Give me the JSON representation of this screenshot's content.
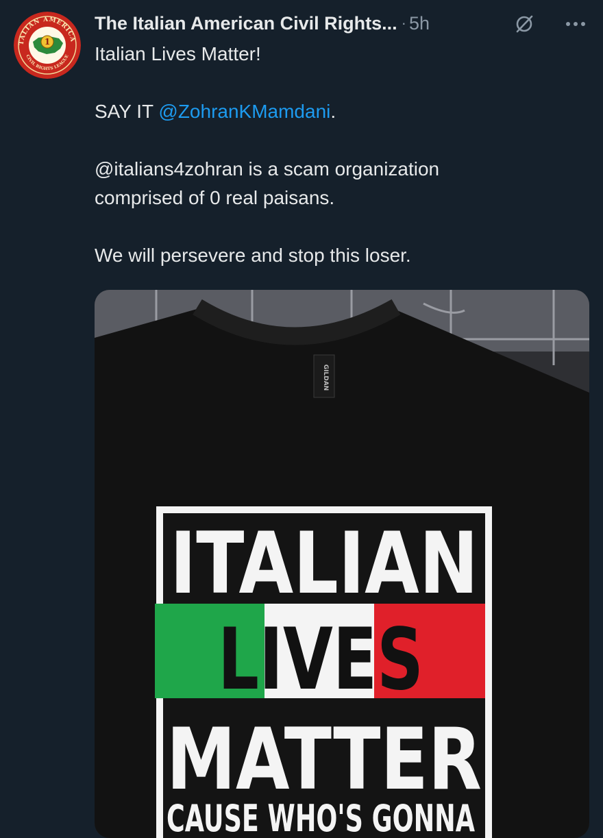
{
  "post": {
    "author_name": "The Italian American Civil Rights...",
    "separator": "·",
    "time": "5h",
    "avatar": {
      "arc_top": "ITALIAN AMERICAN",
      "arc_bottom": "CIVIL RIGHTS LEAGUE",
      "center_number": "1"
    },
    "lines": {
      "line1": "Italian Lives Matter!",
      "line2_prefix": "SAY IT ",
      "line2_mention": "@ZohranKMamdani",
      "line2_suffix": ".",
      "line3": "@italians4zohran is a scam organization",
      "line4": "comprised of 0 real paisans.",
      "line5": "We will persevere and stop this loser."
    }
  },
  "media": {
    "tag_text": "GILDAN",
    "shirt_line1": "ITALIAN",
    "shirt_line2": "LIVES",
    "shirt_line3": "MATTER",
    "shirt_line4": "CAUSE WHO'S GONNA",
    "flag_colors": {
      "green": "#1fa64a",
      "white": "#f4f4f4",
      "red": "#e0202a"
    }
  },
  "icons": {
    "grok": "grok-icon",
    "more": "more-options-icon"
  }
}
